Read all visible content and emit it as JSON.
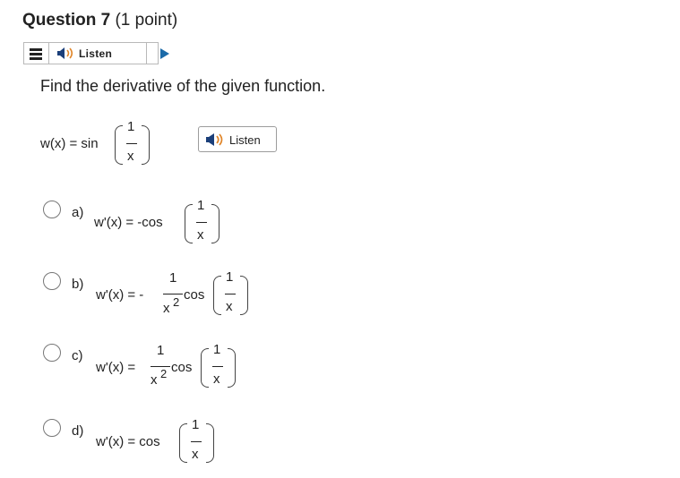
{
  "question": {
    "title": "Question 7",
    "points": "(1 point)"
  },
  "toolbar": {
    "menu_icon": "menu-icon",
    "speaker_icon": "speaker-icon",
    "listen_label": "Listen",
    "play_icon": "play-icon"
  },
  "prompt": "Find the derivative of the given function.",
  "function": {
    "lhs": "w(x) = sin",
    "numerator": "1",
    "denominator": "x"
  },
  "listen_button": {
    "label": "Listen"
  },
  "options": [
    {
      "letter": "a)",
      "lhs": "w'(x) = -cos",
      "arg_num": "1",
      "arg_den": "x"
    },
    {
      "letter": "b)",
      "lhs": "w'(x) = -",
      "coef_num": "1",
      "coef_den": "x",
      "coef_exp": "2",
      "func": "cos",
      "arg_num": "1",
      "arg_den": "x"
    },
    {
      "letter": "c)",
      "lhs": "w'(x) =",
      "coef_num": "1",
      "coef_den": "x",
      "coef_exp": "2",
      "func": "cos",
      "arg_num": "1",
      "arg_den": "x"
    },
    {
      "letter": "d)",
      "lhs": "w'(x) = cos",
      "arg_num": "1",
      "arg_den": "x"
    }
  ],
  "colors": {
    "speaker": "#e0862a",
    "play": "#1b6aa8"
  }
}
